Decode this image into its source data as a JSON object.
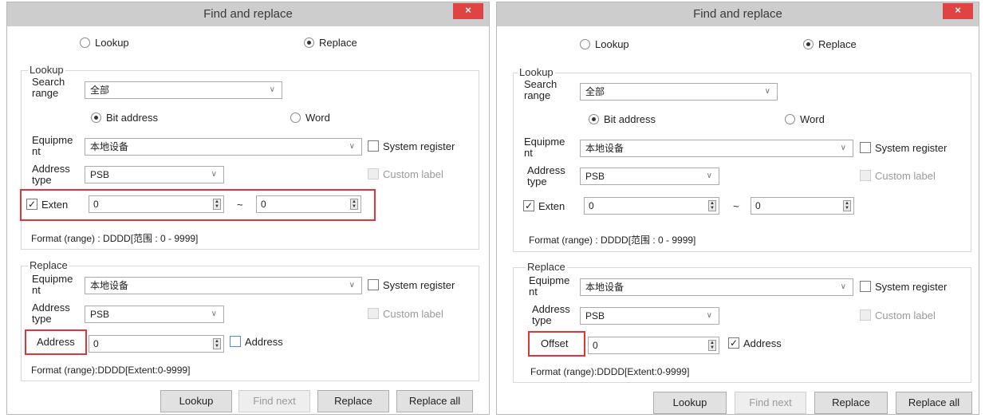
{
  "dialogs": [
    {
      "title": "Find and replace",
      "close_label": "×",
      "mode_lookup": "Lookup",
      "mode_replace": "Replace",
      "lookup": {
        "group_title": "Lookup",
        "search_range_label_1": "Search",
        "search_range_label_2": "range",
        "search_range_value": "全部",
        "bit_address": "Bit address",
        "word": "Word",
        "equipment_label_1": "Equipme",
        "equipment_label_2": "nt",
        "equipment_value": "本地设备",
        "system_register": "System register",
        "address_type_label_1": "Address",
        "address_type_label_2": "type",
        "address_type_value": "PSB",
        "custom_label": "Custom label",
        "exten_label": "Exten",
        "exten_from": "0",
        "tilde": "~",
        "exten_to": "0",
        "format": "Format (range) : DDDD[范围 : 0 - 9999]"
      },
      "replace": {
        "group_title": "Replace",
        "equipment_label_1": "Equipme",
        "equipment_label_2": "nt",
        "equipment_value": "本地设备",
        "system_register": "System register",
        "address_type_label_1": "Address",
        "address_type_label_2": "type",
        "address_type_value": "PSB",
        "custom_label": "Custom label",
        "addr_label": "Address",
        "addr_value": "0",
        "addr_check_label": "Address",
        "format": "Format (range):DDDD[Extent:0-9999]"
      },
      "buttons": {
        "lookup": "Lookup",
        "find_next": "Find next",
        "replace": "Replace",
        "replace_all": "Replace all"
      }
    },
    {
      "title": "Find and replace",
      "close_label": "×",
      "mode_lookup": "Lookup",
      "mode_replace": "Replace",
      "lookup": {
        "group_title": "Lookup",
        "search_range_label_1": "Search",
        "search_range_label_2": "range",
        "search_range_value": "全部",
        "bit_address": "Bit address",
        "word": "Word",
        "equipment_label_1": "Equipme",
        "equipment_label_2": "nt",
        "equipment_value": "本地设备",
        "system_register": "System register",
        "address_type_label_1": "Address",
        "address_type_label_2": "type",
        "address_type_value": "PSB",
        "custom_label": "Custom label",
        "exten_label": "Exten",
        "exten_from": "0",
        "tilde": "~",
        "exten_to": "0",
        "format": "Format (range) : DDDD[范围 : 0 - 9999]"
      },
      "replace": {
        "group_title": "Replace",
        "equipment_label_1": "Equipme",
        "equipment_label_2": "nt",
        "equipment_value": "本地设备",
        "system_register": "System register",
        "address_type_label_1": "Address",
        "address_type_label_2": "type",
        "address_type_value": "PSB",
        "custom_label": "Custom label",
        "addr_label": "Offset",
        "addr_value": "0",
        "addr_check_label": "Address",
        "format": "Format (range):DDDD[Extent:0-9999]"
      },
      "buttons": {
        "lookup": "Lookup",
        "find_next": "Find next",
        "replace": "Replace",
        "replace_all": "Replace all"
      }
    }
  ],
  "colors": {
    "highlight": "#e0353a",
    "titlebar": "#cdcdcd",
    "close": "#e04343"
  }
}
